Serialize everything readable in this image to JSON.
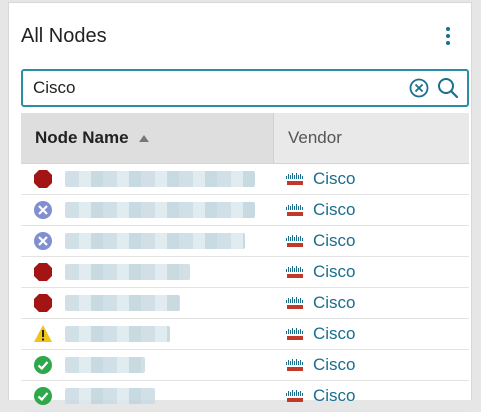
{
  "panel": {
    "title": "All Nodes",
    "menu_icon": "kebab-vertical-icon"
  },
  "search": {
    "value": "Cisco",
    "clear_icon": "clear-circle-icon",
    "search_icon": "search-icon"
  },
  "table": {
    "columns": [
      {
        "label": "Node Name",
        "sort": "ascending"
      },
      {
        "label": "Vendor"
      }
    ],
    "rows": [
      {
        "status": "down",
        "node_name": "",
        "vendor": "Cisco"
      },
      {
        "status": "unmanaged",
        "node_name": "",
        "vendor": "Cisco"
      },
      {
        "status": "unmanaged",
        "node_name": "",
        "vendor": "Cisco"
      },
      {
        "status": "down",
        "node_name": "",
        "vendor": "Cisco"
      },
      {
        "status": "down",
        "node_name": "",
        "vendor": "Cisco"
      },
      {
        "status": "warning",
        "node_name": "",
        "vendor": "Cisco"
      },
      {
        "status": "up",
        "node_name": "",
        "vendor": "Cisco"
      },
      {
        "status": "up",
        "node_name": "",
        "vendor": "Cisco"
      }
    ]
  },
  "colors": {
    "accent": "#1a6e8e",
    "down": "#a31515",
    "unmanaged": "#7f8fd0",
    "warning": "#f0c419",
    "up": "#2ea84a"
  }
}
